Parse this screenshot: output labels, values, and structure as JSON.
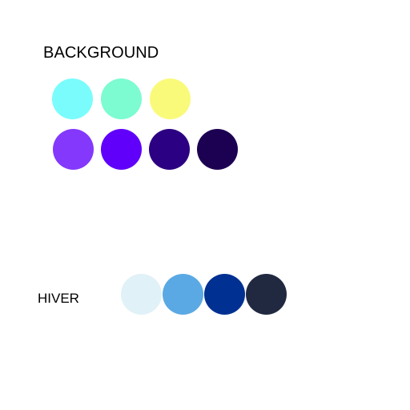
{
  "background_palette": {
    "title": "BACKGROUND",
    "rows": [
      [
        {
          "color": "#7afcfc"
        },
        {
          "color": "#7cfcd0"
        },
        {
          "color": "#fafa7a"
        }
      ],
      [
        {
          "color": "#8438fc"
        },
        {
          "color": "#6000fa"
        },
        {
          "color": "#2c0082"
        },
        {
          "color": "#1c0052"
        }
      ]
    ]
  },
  "hiver_palette": {
    "title": "HIVER",
    "swatches": [
      {
        "color": "#e0f1f7"
      },
      {
        "color": "#5aa9e4"
      },
      {
        "color": "#003092"
      },
      {
        "color": "#202940"
      }
    ]
  }
}
